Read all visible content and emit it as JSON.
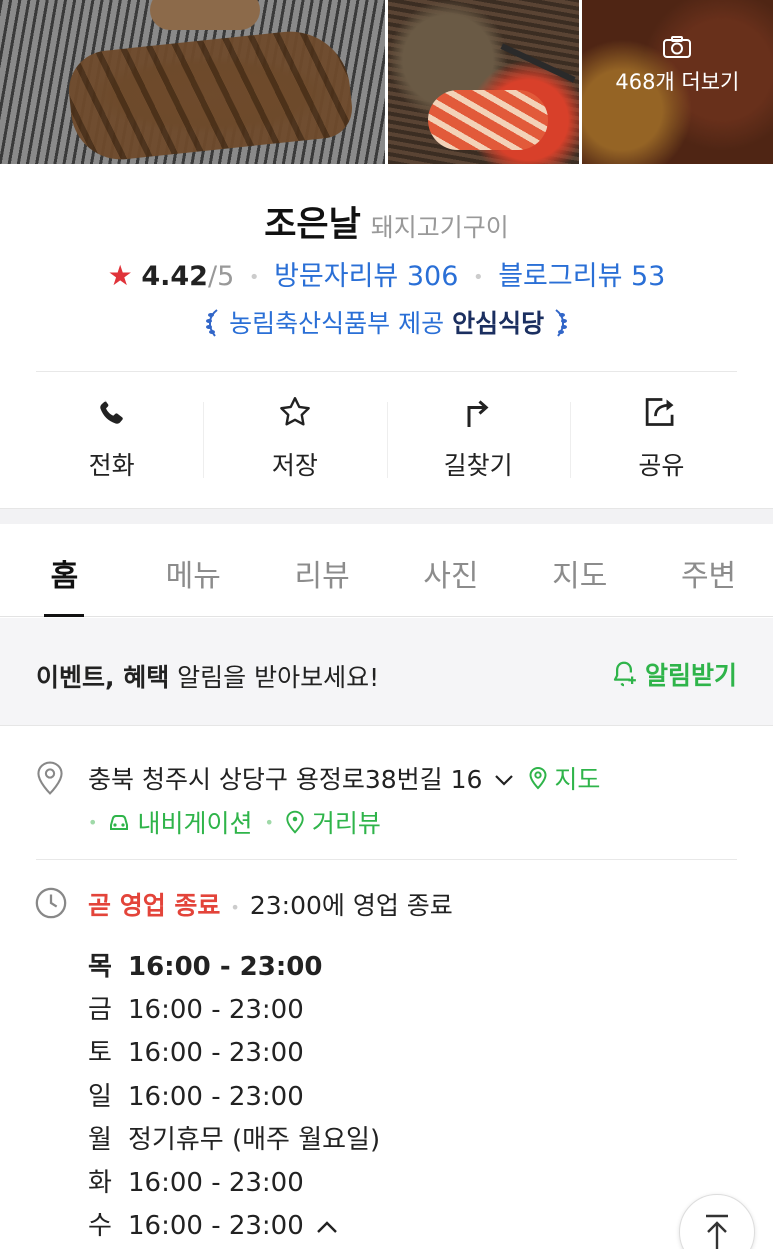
{
  "photos": {
    "more_label": "468개 더보기"
  },
  "place": {
    "name": "조은날",
    "category": "돼지고기구이",
    "rating": "4.42",
    "rating_max": "/5",
    "visitor_reviews": "방문자리뷰 306",
    "blog_reviews": "블로그리뷰 53",
    "badge_org": "농림축산식품부 제공",
    "badge_name": "안심식당"
  },
  "actions": [
    {
      "label": "전화",
      "icon": "phone-icon"
    },
    {
      "label": "저장",
      "icon": "star-outline-icon"
    },
    {
      "label": "길찾기",
      "icon": "directions-icon"
    },
    {
      "label": "공유",
      "icon": "share-icon"
    }
  ],
  "tabs": [
    "홈",
    "메뉴",
    "리뷰",
    "사진",
    "지도",
    "주변"
  ],
  "active_tab": "홈",
  "alert": {
    "text_bold": "이벤트, 혜택",
    "text_rest": " 알림을 받아보세요!",
    "button": "알림받기"
  },
  "address": {
    "text": "충북 청주시 상당구 용정로38번길 16",
    "map_link": "지도",
    "navigation_link": "내비게이션",
    "streetview_link": "거리뷰"
  },
  "hours": {
    "status": "곧 영업 종료",
    "status_detail": "23:00에 영업 종료",
    "days": [
      {
        "day": "목",
        "time": "16:00 - 23:00"
      },
      {
        "day": "금",
        "time": "16:00 - 23:00"
      },
      {
        "day": "토",
        "time": "16:00 - 23:00"
      },
      {
        "day": "일",
        "time": "16:00 - 23:00"
      },
      {
        "day": "월",
        "time": "정기휴무 (매주 월요일)"
      },
      {
        "day": "화",
        "time": "16:00 - 23:00"
      },
      {
        "day": "수",
        "time": "16:00 - 23:00"
      }
    ]
  },
  "colors": {
    "accent_green": "#2fb44a",
    "link_blue": "#2a6fd6",
    "status_red": "#e3443a",
    "star_red": "#e0333a"
  }
}
